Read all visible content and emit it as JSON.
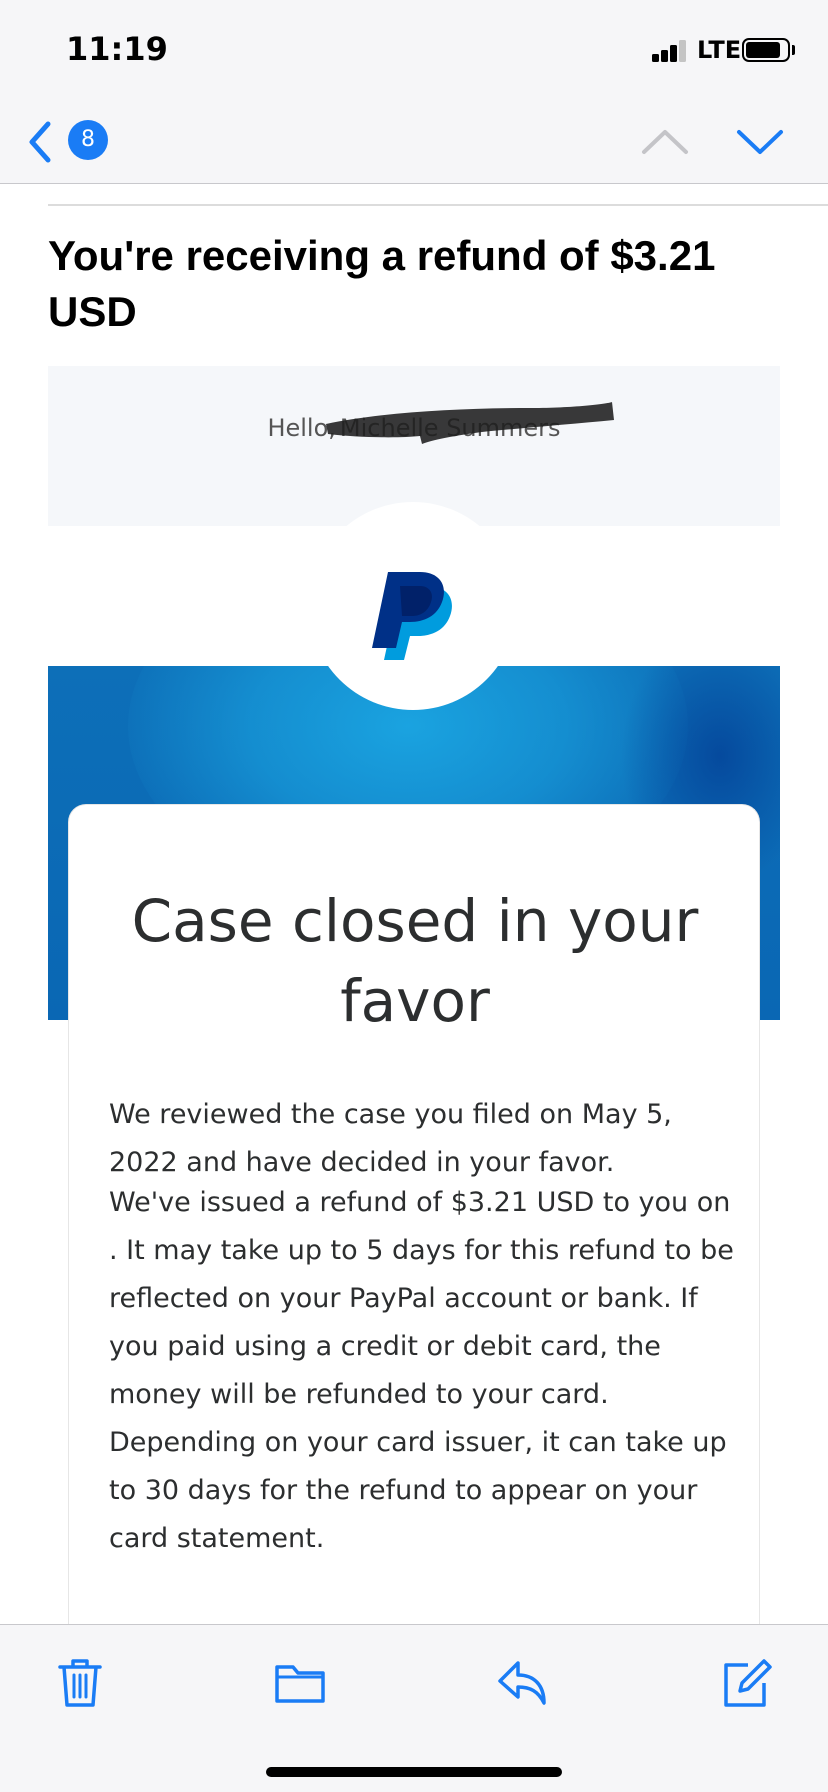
{
  "status_bar": {
    "time": "11:19",
    "network": "LTE",
    "signal_bars_active": 3,
    "signal_bars_total": 4,
    "battery_level": 0.85
  },
  "nav": {
    "unread_count": "8",
    "accent_color": "#1a7cf5"
  },
  "email": {
    "subject": "You're receiving a refund of $3.21 USD",
    "greeting": "Hello,",
    "recipient_name": "Michelle Summers",
    "card_title": "Case closed in your favor",
    "paragraph_1": "We reviewed the case you filed on May 5, 2022 and have decided in your favor.",
    "paragraph_2": "We've issued a refund of $3.21 USD to you on . It may take up to 5 days for this refund to be reflected on your PayPal account or bank. If you paid using a credit or debit card, the money will be refunded to your card. Depending on your card issuer, it can take up to 30 days for the refund to appear on your card statement.",
    "brand_colors": {
      "dark_blue": "#003087",
      "light_blue": "#009cde"
    }
  },
  "toolbar": {
    "icons": [
      "trash-icon",
      "folder-icon",
      "reply-icon",
      "compose-icon"
    ]
  }
}
